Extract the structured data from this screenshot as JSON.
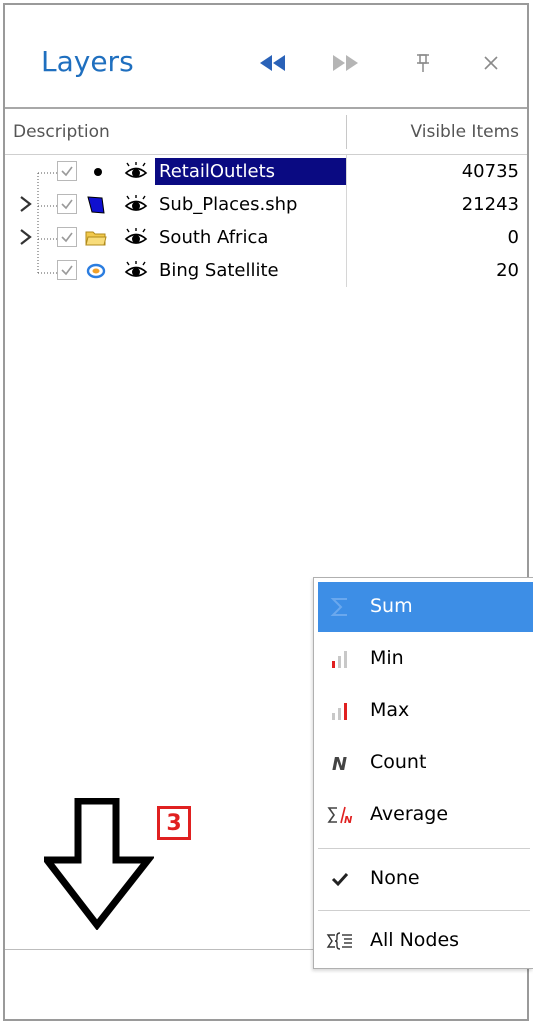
{
  "panel": {
    "title": "Layers",
    "buttons": [
      "rewind-icon",
      "forward-icon",
      "pin-icon",
      "close-icon"
    ]
  },
  "columns": {
    "description": "Description",
    "visible_items": "Visible Items"
  },
  "layers": [
    {
      "name": "RetailOutlets",
      "visible_items": "40735",
      "icon": "point-icon",
      "selected": true,
      "expandable": false
    },
    {
      "name": "Sub_Places.shp",
      "visible_items": "21243",
      "icon": "polygon-icon",
      "selected": false,
      "expandable": true
    },
    {
      "name": "South Africa",
      "visible_items": "0",
      "icon": "folder-icon",
      "selected": false,
      "expandable": true
    },
    {
      "name": "Bing Satellite",
      "visible_items": "20",
      "icon": "bing-icon",
      "selected": false,
      "expandable": false
    }
  ],
  "context_menu": {
    "items": [
      {
        "label": "Sum",
        "icon": "sigma-icon",
        "highlighted": true
      },
      {
        "label": "Min",
        "icon": "min-bar-icon"
      },
      {
        "label": "Max",
        "icon": "max-bar-icon"
      },
      {
        "label": "Count",
        "icon": "count-n-icon"
      },
      {
        "label": "Average",
        "icon": "average-icon"
      },
      {
        "label": "None",
        "icon": "checkmark-icon"
      },
      {
        "label": "All Nodes",
        "icon": "all-nodes-icon"
      }
    ]
  },
  "annotation": {
    "step_number": "3"
  },
  "colors": {
    "title": "#1f6fbf",
    "selection": "#0a0a82",
    "menu_highlight": "#3d8ee6",
    "badge": "#e02020"
  }
}
